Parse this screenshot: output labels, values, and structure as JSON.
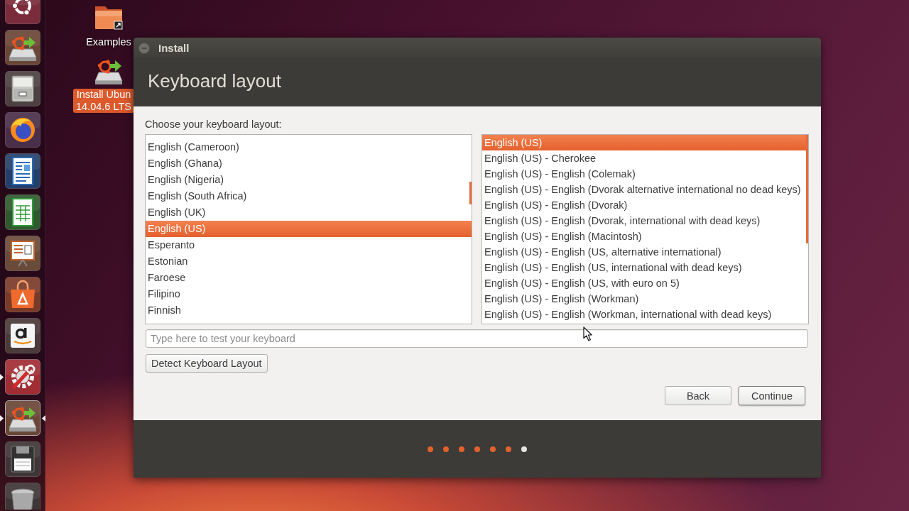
{
  "launcher": [
    {
      "kind": "logo",
      "running": false,
      "active": false
    },
    {
      "kind": "drive",
      "running": false,
      "active": false
    },
    {
      "kind": "cabinet",
      "running": false,
      "active": false
    },
    {
      "kind": "browser",
      "running": false,
      "active": false
    },
    {
      "kind": "document",
      "running": false,
      "active": false
    },
    {
      "kind": "spreadsheet",
      "running": false,
      "active": false
    },
    {
      "kind": "presentation",
      "running": false,
      "active": false
    },
    {
      "kind": "bag",
      "running": false,
      "active": false
    },
    {
      "kind": "letter",
      "running": false,
      "active": false
    },
    {
      "kind": "tools",
      "running": true,
      "active": false
    },
    {
      "kind": "drive",
      "running": true,
      "active": true
    },
    {
      "kind": "floppy",
      "running": false,
      "active": false
    },
    {
      "kind": "bin",
      "running": false,
      "active": false
    }
  ],
  "desktop_icons": [
    {
      "kind": "folder",
      "label": "Examples",
      "selected": false
    },
    {
      "kind": "drive",
      "label": "Install Ubun\n14.04.6 LTS",
      "selected": true
    }
  ],
  "window": {
    "title": "Install"
  },
  "page": {
    "heading": "Keyboard layout",
    "prompt": "Choose your keyboard layout:"
  },
  "layouts": [
    {
      "label": "English (Cameroon)",
      "selected": false
    },
    {
      "label": "English (Ghana)",
      "selected": false
    },
    {
      "label": "English (Nigeria)",
      "selected": false
    },
    {
      "label": "English (South Africa)",
      "selected": false
    },
    {
      "label": "English (UK)",
      "selected": false
    },
    {
      "label": "English (US)",
      "selected": true
    },
    {
      "label": "Esperanto",
      "selected": false
    },
    {
      "label": "Estonian",
      "selected": false
    },
    {
      "label": "Faroese",
      "selected": false
    },
    {
      "label": "Filipino",
      "selected": false
    },
    {
      "label": "Finnish",
      "selected": false
    }
  ],
  "variants": [
    {
      "label": "English (US)",
      "selected": true
    },
    {
      "label": "English (US) - Cherokee",
      "selected": false
    },
    {
      "label": "English (US) - English (Colemak)",
      "selected": false
    },
    {
      "label": "English (US) - English (Dvorak alternative international no dead keys)",
      "selected": false
    },
    {
      "label": "English (US) - English (Dvorak)",
      "selected": false
    },
    {
      "label": "English (US) - English (Dvorak, international with dead keys)",
      "selected": false
    },
    {
      "label": "English (US) - English (Macintosh)",
      "selected": false
    },
    {
      "label": "English (US) - English (US, alternative international)",
      "selected": false
    },
    {
      "label": "English (US) - English (US, international with dead keys)",
      "selected": false
    },
    {
      "label": "English (US) - English (US, with euro on 5)",
      "selected": false
    },
    {
      "label": "English (US) - English (Workman)",
      "selected": false
    },
    {
      "label": "English (US) - English (Workman, international with dead keys)",
      "selected": false
    }
  ],
  "test_field": {
    "placeholder": "Type here to test your keyboard"
  },
  "detect_button": "Detect Keyboard Layout",
  "nav_buttons": [
    {
      "label": "Back",
      "default": false
    },
    {
      "label": "Continue",
      "default": true
    }
  ],
  "progress": [
    {
      "current": false
    },
    {
      "current": false
    },
    {
      "current": false
    },
    {
      "current": false
    },
    {
      "current": false
    },
    {
      "current": false
    },
    {
      "current": true
    }
  ]
}
